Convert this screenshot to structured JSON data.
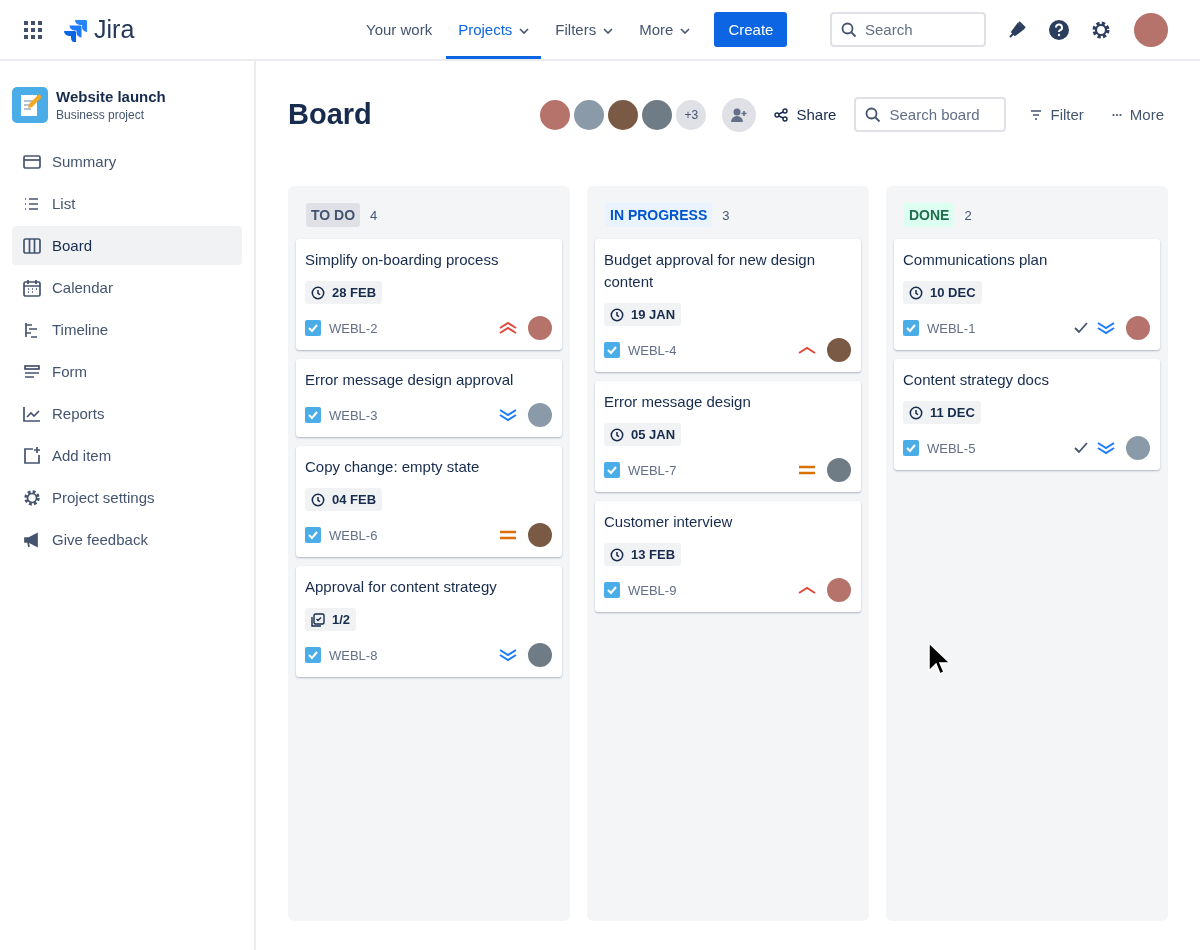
{
  "topnav": {
    "logo": "Jira",
    "items": [
      {
        "label": "Your work",
        "dropdown": false,
        "selected": false
      },
      {
        "label": "Projects",
        "dropdown": true,
        "selected": true
      },
      {
        "label": "Filters",
        "dropdown": true,
        "selected": false
      },
      {
        "label": "More",
        "dropdown": true,
        "selected": false
      }
    ],
    "create": "Create",
    "search": {
      "placeholder": "Search"
    }
  },
  "sidebar": {
    "project": {
      "name": "Website launch",
      "type": "Business project"
    },
    "items": [
      {
        "label": "Summary",
        "selected": false
      },
      {
        "label": "List",
        "selected": false
      },
      {
        "label": "Board",
        "selected": true
      },
      {
        "label": "Calendar",
        "selected": false
      },
      {
        "label": "Timeline",
        "selected": false
      },
      {
        "label": "Form",
        "selected": false
      },
      {
        "label": "Reports",
        "selected": false
      },
      {
        "label": "Add item",
        "selected": false
      },
      {
        "label": "Project settings",
        "selected": false
      },
      {
        "label": "Give feedback",
        "selected": false
      }
    ]
  },
  "header": {
    "title": "Board",
    "extra_people": "+3",
    "share": "Share",
    "search": {
      "placeholder": "Search board"
    },
    "filter": "Filter",
    "more": "More"
  },
  "columns": [
    {
      "title": "TO DO",
      "kind": "todo",
      "count": "4",
      "cards": [
        {
          "title": "Simplify on-boarding process",
          "date": "28 FEB",
          "key": "WEBL-2",
          "priority": {
            "kind": "highest"
          },
          "done": false
        },
        {
          "title": "Error message design approval",
          "key": "WEBL-3",
          "priority": {
            "kind": "lowest"
          },
          "done": false
        },
        {
          "title": "Copy change: empty state",
          "date": "04 FEB",
          "key": "WEBL-6",
          "priority": {
            "kind": "medium"
          },
          "done": false
        },
        {
          "title": "Approval for content strategy",
          "subtasks": "1/2",
          "key": "WEBL-8",
          "priority": {
            "kind": "lowest"
          },
          "done": false
        }
      ]
    },
    {
      "title": "IN PROGRESS",
      "kind": "progress",
      "count": "3",
      "cards": [
        {
          "title": "Budget approval for new design content",
          "date": "19 JAN",
          "key": "WEBL-4",
          "priority": {
            "kind": "high"
          },
          "done": false
        },
        {
          "title": "Error message design",
          "date": "05 JAN",
          "key": "WEBL-7",
          "priority": {
            "kind": "medium"
          },
          "done": false
        },
        {
          "title": "Customer interview",
          "date": "13 FEB",
          "key": "WEBL-9",
          "priority": {
            "kind": "high"
          },
          "done": false
        }
      ]
    },
    {
      "title": "DONE",
      "kind": "done",
      "count": "2",
      "cards": [
        {
          "title": "Communications plan",
          "date": "10 DEC",
          "key": "WEBL-1",
          "priority": {
            "kind": "lowest"
          },
          "done": true
        },
        {
          "title": "Content strategy docs",
          "date": "11 DEC",
          "key": "WEBL-5",
          "priority": {
            "kind": "lowest"
          },
          "done": true
        }
      ]
    }
  ]
}
